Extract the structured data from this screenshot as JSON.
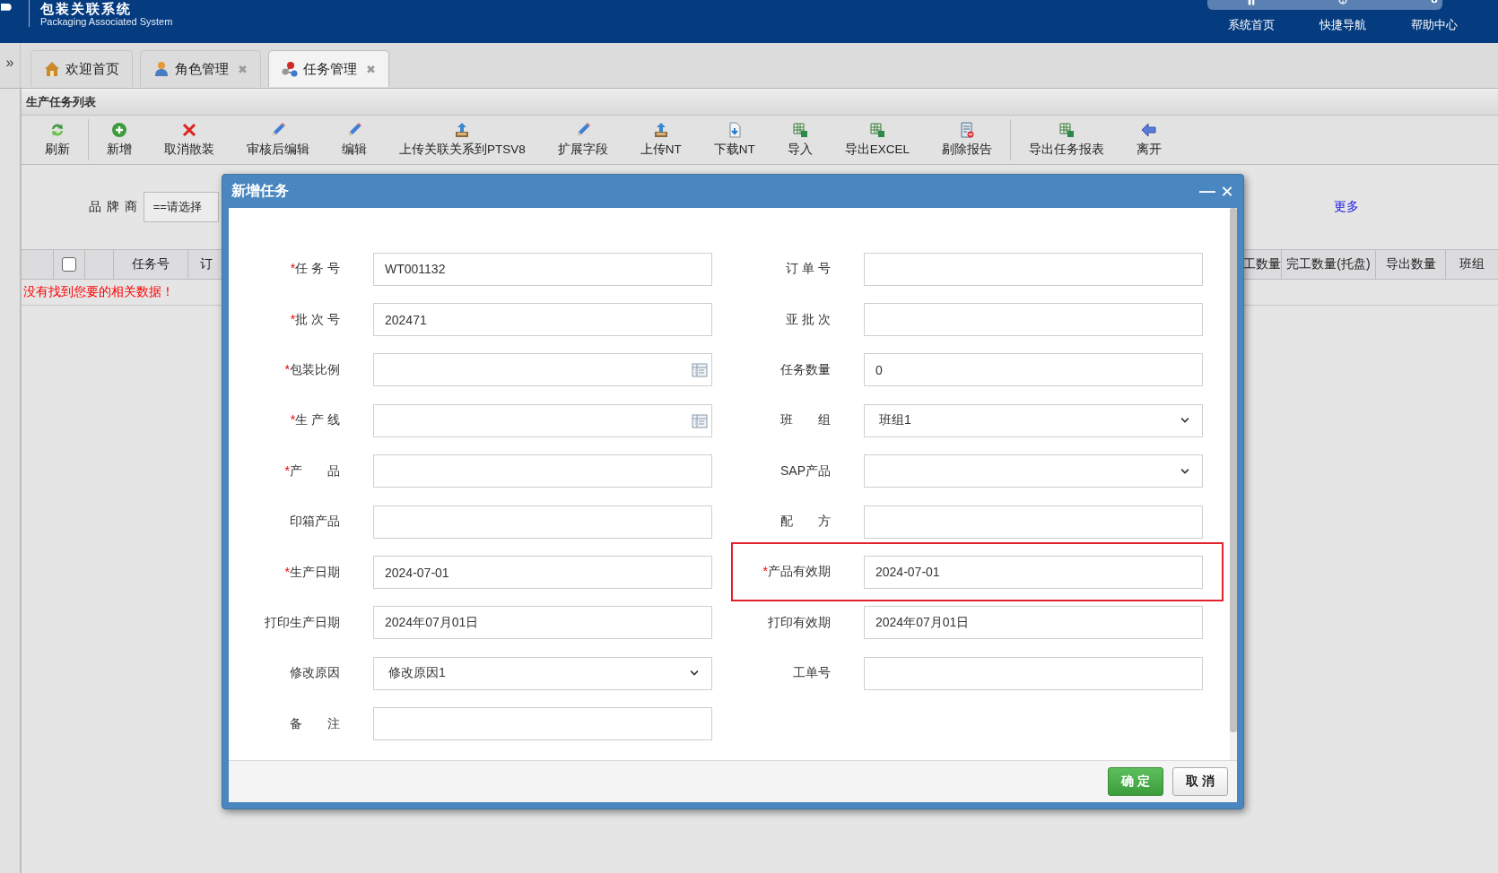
{
  "header": {
    "title": "包装关联系统",
    "subtitle": "Packaging Associated System",
    "nav": [
      {
        "label": "系统首页"
      },
      {
        "label": "快捷导航"
      },
      {
        "label": "帮助中心"
      }
    ]
  },
  "collapse_toggle": "»",
  "tabs": [
    {
      "label": "欢迎首页",
      "selected": false
    },
    {
      "label": "角色管理",
      "close": "✖",
      "selected": false
    },
    {
      "label": "任务管理",
      "close": "✖",
      "selected": true
    }
  ],
  "panel": {
    "title": "生产任务列表",
    "toolbar_groups": [
      [
        "刷新"
      ],
      [
        "新增",
        "取消散装",
        "审核后编辑",
        "编辑",
        "上传关联关系到PTSV8",
        "扩展字段",
        "上传NT",
        "下载NT",
        "导入",
        "导出EXCEL",
        "剔除报告"
      ],
      [
        "导出任务报表",
        "离开"
      ]
    ],
    "filter": {
      "label": "品 牌 商",
      "value": "==请选择",
      "more_link": "更多"
    },
    "columns_left": [
      {
        "kind": "blank"
      },
      {
        "kind": "checkbox",
        "checked": false
      },
      {
        "kind": "blank"
      },
      {
        "kind": "text",
        "label": "任务号"
      },
      {
        "kind": "text",
        "label": "订"
      }
    ],
    "columns_right": [
      {
        "kind": "text",
        "label": "工数量"
      },
      {
        "kind": "text",
        "label": "完工数量(托盘)"
      },
      {
        "kind": "text",
        "label": "导出数量"
      },
      {
        "kind": "text",
        "label": "班组"
      }
    ],
    "empty_message": "没有找到您要的相关数据！"
  },
  "dialog": {
    "title": "新增任务",
    "minimize": "—",
    "close": "✕",
    "left_fields": [
      {
        "label": "任 务 号",
        "required_mark": "*",
        "kind": "text",
        "value": "WT001132",
        "highlighted": false
      },
      {
        "label": "批 次 号",
        "required_mark": "*",
        "kind": "text",
        "value": "202471",
        "highlighted": false
      },
      {
        "label": "包装比例",
        "required_mark": "*",
        "kind": "picker",
        "highlighted": false
      },
      {
        "label": "生 产 线",
        "required_mark": "*",
        "kind": "picker",
        "highlighted": false
      },
      {
        "label": "产　　品",
        "required_mark": "*",
        "kind": "text",
        "highlighted": false
      },
      {
        "label": "印箱产品",
        "kind": "text",
        "highlighted": false
      },
      {
        "label": "生产日期",
        "required_mark": "*",
        "kind": "text",
        "value": "2024-07-01",
        "highlighted": false
      },
      {
        "label": "打印生产日期",
        "kind": "text",
        "value": "2024年07月01日",
        "highlighted": false
      },
      {
        "label": "修改原因",
        "kind": "select",
        "value": "修改原因1",
        "highlighted": false
      },
      {
        "label": "备　　注",
        "kind": "text",
        "highlighted": false
      }
    ],
    "right_fields": [
      {
        "label": "订 单 号",
        "kind": "text",
        "highlighted": false
      },
      {
        "label": "亚 批 次",
        "kind": "text",
        "highlighted": false
      },
      {
        "label": "任务数量",
        "kind": "text",
        "value": "0",
        "highlighted": false
      },
      {
        "label": "班　　组",
        "kind": "select",
        "value": "班组1",
        "highlighted": false
      },
      {
        "label": "SAP产品",
        "kind": "select",
        "highlighted": false
      },
      {
        "label": "配　　方",
        "kind": "text",
        "highlighted": false
      },
      {
        "label": "产品有效期",
        "required_mark": "*",
        "kind": "text",
        "value": "2024-07-01",
        "highlighted": true
      },
      {
        "label": "打印有效期",
        "kind": "text",
        "value": "2024年07月01日",
        "highlighted": false
      },
      {
        "label": "工单号",
        "kind": "text",
        "highlighted": false
      }
    ],
    "buttons": [
      {
        "label": "确 定",
        "kind": "primary"
      },
      {
        "label": "取 消",
        "kind": "default"
      }
    ]
  }
}
